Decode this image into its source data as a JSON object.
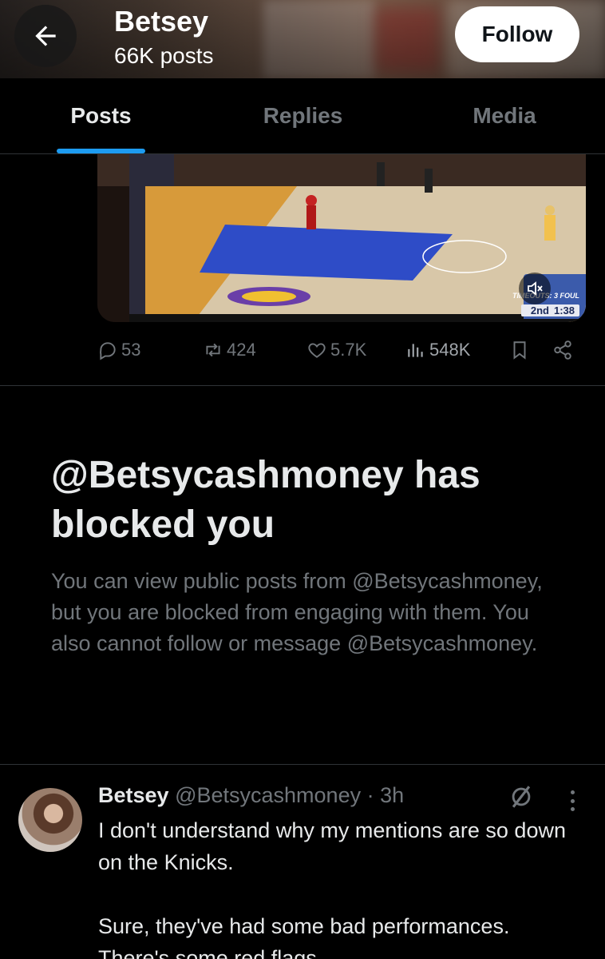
{
  "header": {
    "title": "Betsey",
    "posts_count": "66K posts",
    "follow_label": "Follow",
    "back_icon": "arrow-left-icon"
  },
  "tabs": [
    {
      "label": "Posts",
      "active": true
    },
    {
      "label": "Replies",
      "active": false
    },
    {
      "label": "Media",
      "active": false
    }
  ],
  "video": {
    "scorebug": {
      "timeouts": "TIMEOUTS: 3   FOUL",
      "period": "2nd",
      "clock": "1:38"
    },
    "mute_icon": "speaker-muted-icon"
  },
  "post_actions": {
    "replies": "53",
    "reposts": "424",
    "likes": "5.7K",
    "views": "548K"
  },
  "blocked": {
    "title": "@Betsycashmoney has blocked you",
    "body": "You can view public posts from @Betsycashmoney, but you are blocked from engaging with them. You also cannot follow or message @Betsycashmoney."
  },
  "post": {
    "display_name": "Betsey",
    "handle": "@Betsycashmoney",
    "time": "· 3h",
    "text": "I don't understand why my mentions are so down on the Knicks.\n\nSure, they've had some bad performances. There's some red flags."
  },
  "colors": {
    "accent": "#1d9bf0",
    "muted_text": "#71767b",
    "text": "#e7e9ea",
    "background": "#000000",
    "divider": "#2f3336"
  }
}
